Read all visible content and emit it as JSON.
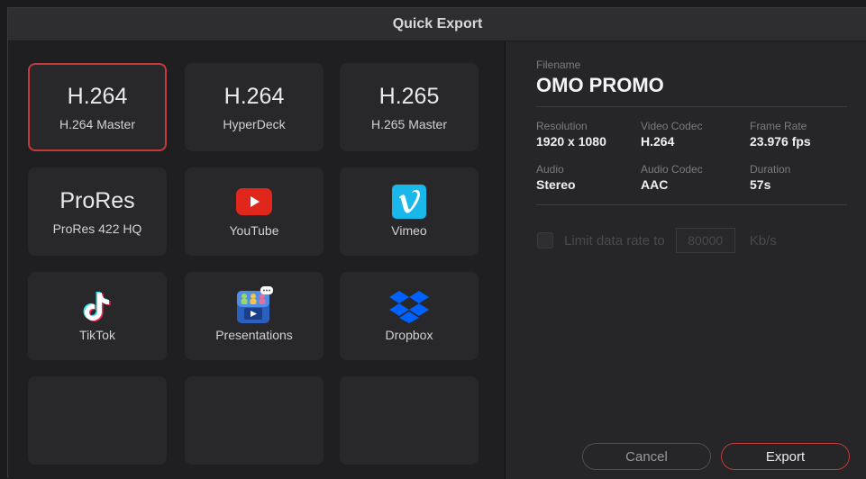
{
  "window": {
    "title": "Quick Export"
  },
  "presets": [
    {
      "big": "H.264",
      "label": "H.264 Master"
    },
    {
      "big": "H.264",
      "label": "HyperDeck"
    },
    {
      "big": "H.265",
      "label": "H.265 Master"
    },
    {
      "big": "ProRes",
      "label": "ProRes 422 HQ"
    },
    {
      "label": "YouTube",
      "icon": "youtube-icon"
    },
    {
      "label": "Vimeo",
      "icon": "vimeo-icon"
    },
    {
      "label": "TikTok",
      "icon": "tiktok-icon"
    },
    {
      "label": "Presentations",
      "icon": "presentations-icon"
    },
    {
      "label": "Dropbox",
      "icon": "dropbox-icon"
    }
  ],
  "details": {
    "filename_label": "Filename",
    "filename": "OMO PROMO",
    "resolution_label": "Resolution",
    "resolution": "1920 x 1080",
    "video_codec_label": "Video Codec",
    "video_codec": "H.264",
    "frame_rate_label": "Frame Rate",
    "frame_rate": "23.976 fps",
    "audio_label": "Audio",
    "audio": "Stereo",
    "audio_codec_label": "Audio Codec",
    "audio_codec": "AAC",
    "duration_label": "Duration",
    "duration": "57s"
  },
  "limit": {
    "label": "Limit data rate to",
    "value": "80000",
    "unit": "Kb/s",
    "checked": false
  },
  "buttons": {
    "cancel": "Cancel",
    "export": "Export"
  },
  "colors": {
    "accent": "#c23a3a",
    "youtube": "#e1261c",
    "vimeo": "#1ab7ea",
    "dropbox": "#0061fe"
  }
}
